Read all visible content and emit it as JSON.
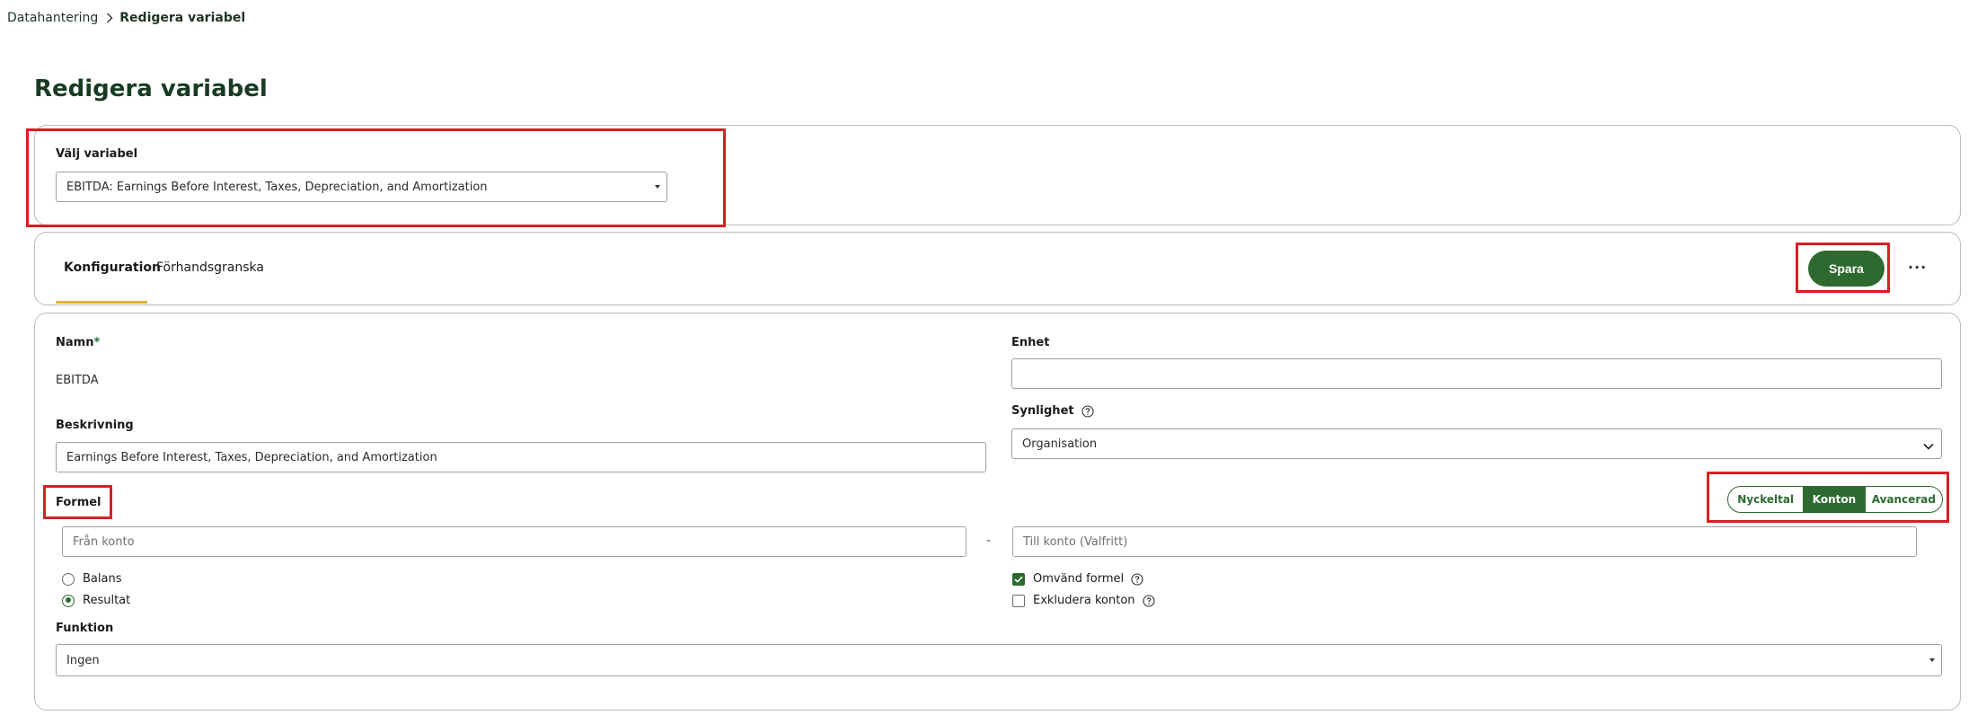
{
  "breadcrumb": {
    "parent": "Datahantering",
    "current": "Redigera variabel"
  },
  "page_title": "Redigera variabel",
  "variable_select": {
    "label": "Välj variabel",
    "value": "EBITDA: Earnings Before Interest, Taxes, Depreciation, and Amortization"
  },
  "tabs": [
    {
      "label": "Konfiguration",
      "active": true
    },
    {
      "label": "Förhandsgranska",
      "active": false
    }
  ],
  "toolbar": {
    "save_label": "Spara",
    "more_label": "···"
  },
  "form": {
    "name": {
      "label": "Namn",
      "required_mark": "*",
      "value": "EBITDA"
    },
    "unit": {
      "label": "Enhet",
      "value": ""
    },
    "description": {
      "label": "Beskrivning",
      "value": "Earnings Before Interest, Taxes, Depreciation, and Amortization"
    },
    "visibility": {
      "label": "Synlighet",
      "value": "Organisation"
    },
    "formula": {
      "label": "Formel",
      "modes": [
        {
          "label": "Nyckeltal",
          "active": false
        },
        {
          "label": "Konton",
          "active": true
        },
        {
          "label": "Avancerad",
          "active": false
        }
      ],
      "from_account_placeholder": "Från konto",
      "range_separator": "-",
      "to_account_placeholder": "Till konto (Valfritt)",
      "account_types": [
        {
          "label": "Balans",
          "checked": false
        },
        {
          "label": "Resultat",
          "checked": true
        }
      ],
      "options": [
        {
          "label": "Omvänd formel",
          "checked": true
        },
        {
          "label": "Exkludera konton",
          "checked": false
        }
      ]
    },
    "function": {
      "label": "Funktion",
      "value": "Ingen"
    }
  },
  "icons": {
    "breadcrumb_separator": "chevron-right-icon",
    "help": "question-circle-icon",
    "select_caret": "caret-down-icon",
    "check": "checkmark-icon"
  },
  "colors": {
    "primary": "#2e6a30",
    "tab_indicator": "#e5b52a",
    "title": "#173b23",
    "annotation": "#d81f26"
  }
}
